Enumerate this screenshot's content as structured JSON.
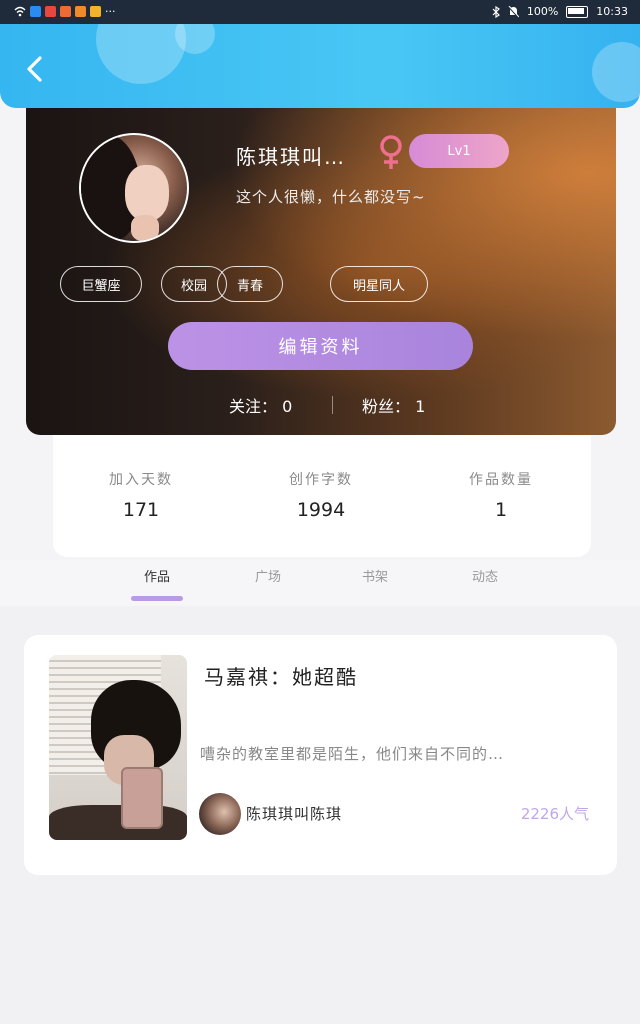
{
  "status_bar": {
    "battery": "100%",
    "time": "10:33",
    "more": "···"
  },
  "profile": {
    "username": "陈琪琪叫…",
    "level": "Lv1",
    "bio": "这个人很懒，什么都没写~",
    "tags": [
      "巨蟹座",
      "校园",
      "青春",
      "明星同人"
    ],
    "edit_button": "编辑资料",
    "following_label": "关注：",
    "following_count": "0",
    "followers_label": "粉丝：",
    "followers_count": "1"
  },
  "stats": [
    {
      "label": "加入天数",
      "value": "171"
    },
    {
      "label": "创作字数",
      "value": "1994"
    },
    {
      "label": "作品数量",
      "value": "1"
    }
  ],
  "tabs": [
    {
      "label": "作品"
    },
    {
      "label": "广场"
    },
    {
      "label": "书架"
    },
    {
      "label": "动态"
    }
  ],
  "work": {
    "title": "马嘉祺：她超酷",
    "summary": "嘈杂的教室里都是陌生，他们来自不同的…",
    "author": "陈琪琪叫陈琪",
    "popularity": "2226人气"
  },
  "colors": {
    "header_blue": "#3ab8f2",
    "accent_purple": "#b08ae2",
    "gender_pink": "#ee6f8e"
  },
  "icons": [
    "back-arrow-icon",
    "female-gender-icon",
    "wifi-icon",
    "bluetooth-icon",
    "mute-icon",
    "battery-icon"
  ]
}
